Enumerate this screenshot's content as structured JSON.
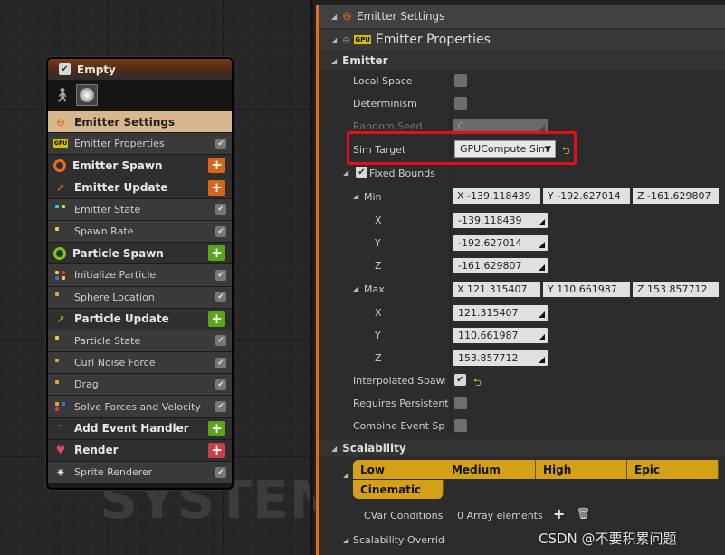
{
  "graph": {
    "watermark": "SYSTEM",
    "node": {
      "title": "Empty",
      "rows": [
        {
          "label": "Emitter Settings",
          "kind": "selected",
          "icon": "emitter-settings-icon",
          "color": "#e46d1c"
        },
        {
          "label": "Emitter Properties",
          "kind": "module",
          "icon": "gpu-icon",
          "color": "#d4c000"
        },
        {
          "label": "Emitter Spawn",
          "kind": "section",
          "icon": "ring-icon",
          "color": "#e46d1c",
          "plus_color": "#d9641c"
        },
        {
          "label": "Emitter Update",
          "kind": "section",
          "icon": "arrow-up-right-icon",
          "color": "#e46d1c",
          "plus_color": "#d9641c"
        },
        {
          "label": "Emitter State",
          "kind": "module",
          "icon": "dots-icon",
          "dots": [
            "#2fd4c8",
            "#e8d23c",
            "",
            ""
          ]
        },
        {
          "label": "Spawn Rate",
          "kind": "module",
          "icon": "dot-icon",
          "dots": [
            "#e8d23c",
            "",
            "",
            ""
          ]
        },
        {
          "label": "Particle Spawn",
          "kind": "section",
          "icon": "ring-icon",
          "color": "#7ac71a",
          "plus_color": "#5aa51a"
        },
        {
          "label": "Initialize Particle",
          "kind": "module",
          "icon": "dots-icon",
          "dots": [
            "#e8d23c",
            "#e23a3a",
            "#3a6ee2",
            "#e8d23c"
          ]
        },
        {
          "label": "Sphere Location",
          "kind": "module",
          "icon": "dot-icon",
          "dots": [
            "#e8a03c",
            "",
            "",
            ""
          ]
        },
        {
          "label": "Particle Update",
          "kind": "section",
          "icon": "arrow-up-right-icon",
          "color": "#7ac71a",
          "plus_color": "#5aa51a"
        },
        {
          "label": "Particle State",
          "kind": "module",
          "icon": "dot-icon",
          "dots": [
            "#e8d23c",
            "",
            "",
            ""
          ]
        },
        {
          "label": "Curl Noise Force",
          "kind": "module",
          "icon": "dot-icon",
          "dots": [
            "#e8a03c",
            "",
            "",
            ""
          ]
        },
        {
          "label": "Drag",
          "kind": "module",
          "icon": "dot-icon",
          "dots": [
            "#e8a03c",
            "",
            "",
            ""
          ]
        },
        {
          "label": "Solve Forces and Velocity",
          "kind": "module",
          "icon": "dots-icon",
          "dots": [
            "#e8a03c",
            "#3a6ee2",
            "#e23a3a",
            ""
          ]
        },
        {
          "label": "Add Event Handler",
          "kind": "section",
          "icon": "wifi-icon",
          "color": "#7ac71a",
          "plus_color": "#5aa51a"
        },
        {
          "label": "Render",
          "kind": "section",
          "icon": "heart-icon",
          "color": "#e24a5a",
          "plus_color": "#c8404e"
        },
        {
          "label": "Sprite Renderer",
          "kind": "module",
          "icon": "sparkle-icon",
          "color": "#eeeeee"
        }
      ]
    }
  },
  "panel": {
    "header": "Emitter Settings",
    "subheader": "Emitter Properties",
    "category_emitter": "Emitter",
    "local_space": "Local Space",
    "determinism": "Determinism",
    "random_seed": "Random Seed",
    "random_seed_value": "0",
    "sim_target": "Sim Target",
    "sim_target_value": "GPUCompute Sim",
    "fixed_bounds": "Fixed Bounds",
    "min": "Min",
    "min_x_vec": "X  -139.118439",
    "min_y_vec": "Y  -192.627014",
    "min_z_vec": "Z  -161.629807",
    "x": "X",
    "y": "Y",
    "z": "Z",
    "min_x": "-139.118439",
    "min_y": "-192.627014",
    "min_z": "-161.629807",
    "max": "Max",
    "max_x_vec": "X  121.315407",
    "max_y_vec": "Y  110.661987",
    "max_z_vec": "Z  153.857712",
    "max_x": "121.315407",
    "max_y": "110.661987",
    "max_z": "153.857712",
    "interpolated_spawning": "Interpolated Spawning",
    "requires_persistent": "Requires Persistent",
    "combine_event_spawn": "Combine Event Spawn",
    "category_scalability": "Scalability",
    "levels": [
      "Low",
      "Medium",
      "High",
      "Epic"
    ],
    "level_cinematic": "Cinematic",
    "cvar_conditions": "CVar Conditions",
    "array_elements": "0 Array elements",
    "scalability_overrides": "Scalability Overrides"
  },
  "overlay": {
    "csdn": "CSDN @不要积累问题"
  }
}
